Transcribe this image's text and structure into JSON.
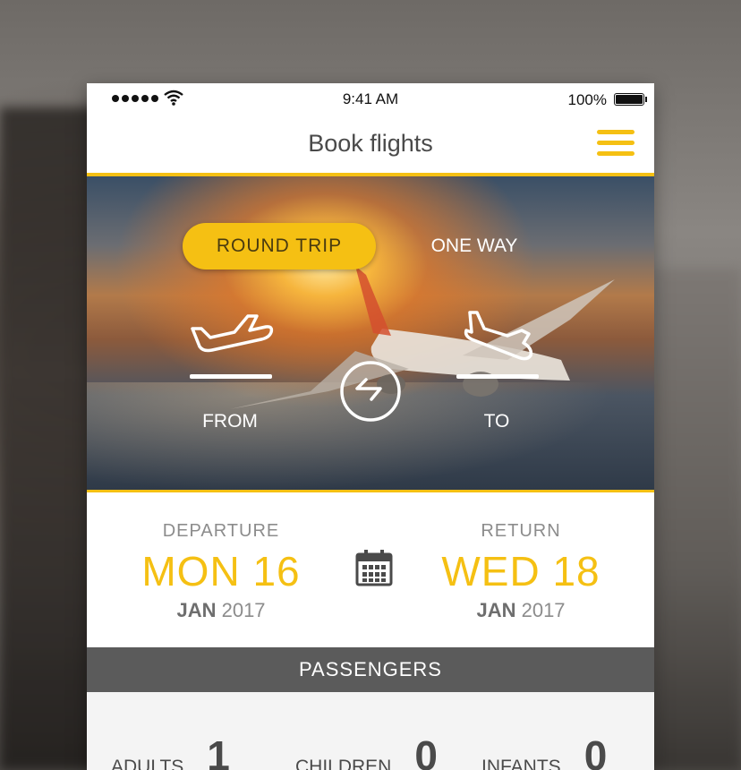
{
  "status_bar": {
    "time": "9:41 AM",
    "battery": "100%"
  },
  "nav": {
    "title": "Book flights",
    "menu_icon": "hamburger-menu-icon"
  },
  "hero": {
    "round_trip": "ROUND TRIP",
    "one_way": "ONE WAY",
    "from_label": "FROM",
    "to_label": "TO",
    "selected_trip": "ROUND TRIP"
  },
  "dates": {
    "departure": {
      "caption": "DEPARTURE",
      "day": "MON 16",
      "month": "JAN",
      "year": "2017"
    },
    "return": {
      "caption": "RETURN",
      "day": "WED 18",
      "month": "JAN",
      "year": "2017"
    }
  },
  "passengers": {
    "header": "PASSENGERS",
    "adults": {
      "label": "ADULTS",
      "count": "1"
    },
    "children": {
      "label": "CHILDREN",
      "count": "0"
    },
    "infants": {
      "label": "INFANTS",
      "count": "0"
    }
  },
  "colors": {
    "accent": "#f5c013",
    "header_bar": "#5b5b5b",
    "text": "#4a4a4a"
  }
}
